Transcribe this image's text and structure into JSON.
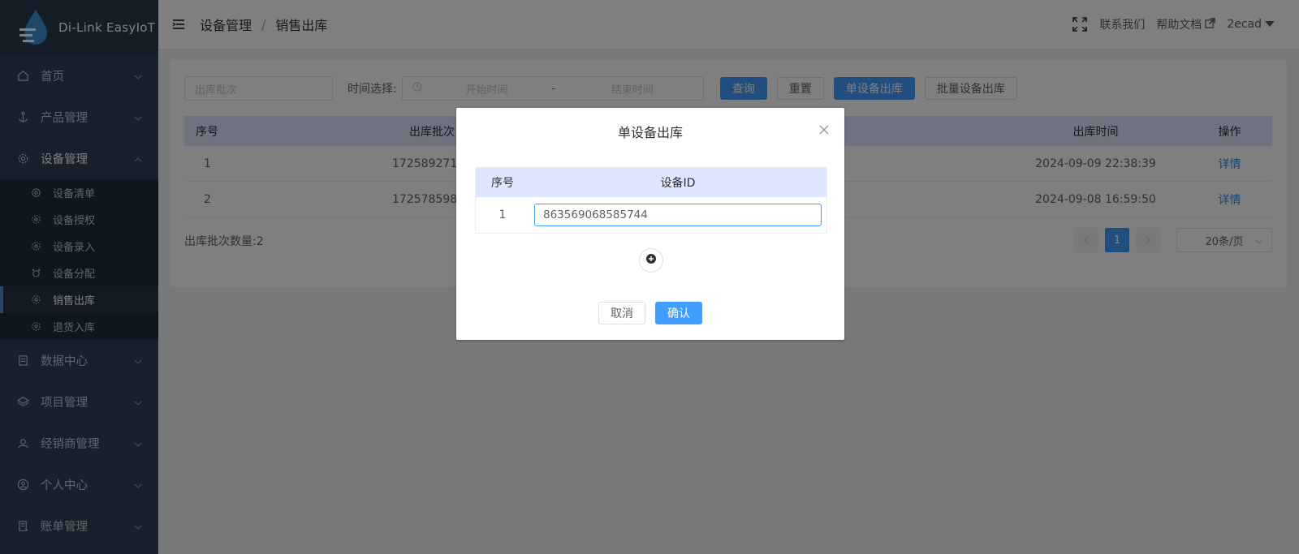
{
  "app": {
    "logo_text": "Di-Link EasyIoT"
  },
  "sidebar": {
    "items": [
      {
        "label": "首页",
        "icon": "home-icon"
      },
      {
        "label": "产品管理",
        "icon": "anchor-icon"
      },
      {
        "label": "设备管理",
        "icon": "gear-icon",
        "expanded": true
      },
      {
        "label": "数据中心",
        "icon": "document-icon"
      },
      {
        "label": "项目管理",
        "icon": "layers-icon"
      },
      {
        "label": "经销商管理",
        "icon": "users-icon"
      },
      {
        "label": "个人中心",
        "icon": "user-circle-icon"
      },
      {
        "label": "账单管理",
        "icon": "bill-icon"
      }
    ],
    "sub_items": [
      {
        "label": "设备清单"
      },
      {
        "label": "设备授权"
      },
      {
        "label": "设备录入"
      },
      {
        "label": "设备分配"
      },
      {
        "label": "销售出库",
        "active": true
      },
      {
        "label": "退货入库"
      }
    ]
  },
  "header": {
    "breadcrumb": [
      "设备管理",
      "销售出库"
    ],
    "separator": "/",
    "contact": "联系我们",
    "help": "帮助文档",
    "user": "2ecad"
  },
  "filters": {
    "batch_placeholder": "出库批次",
    "time_label": "时间选择:",
    "start_placeholder": "开始时间",
    "range_sep": "-",
    "end_placeholder": "结束时间",
    "query": "查询",
    "reset": "重置",
    "single_out": "单设备出库",
    "batch_out": "批量设备出库"
  },
  "table": {
    "headers": [
      "序号",
      "出库批次",
      "",
      "出库时间",
      "操作"
    ],
    "rows": [
      {
        "index": "1",
        "batch": "17258927180",
        "time": "2024-09-09 22:38:39",
        "action": "详情"
      },
      {
        "index": "2",
        "batch": "17257859897",
        "time": "2024-09-08 16:59:50",
        "action": "详情"
      }
    ]
  },
  "footer": {
    "count": "出库批次数量:2",
    "page": "1",
    "page_size": "20条/页"
  },
  "dialog": {
    "title": "单设备出库",
    "headers": [
      "序号",
      "设备ID"
    ],
    "rows": [
      {
        "index": "1",
        "device_id": "863569068585744"
      }
    ],
    "cancel": "取消",
    "confirm": "确认"
  },
  "colors": {
    "sidebar_bg": "#304156",
    "primary": "#409eff",
    "table_header_bg": "#dfe6ff",
    "link": "#1890ff"
  }
}
